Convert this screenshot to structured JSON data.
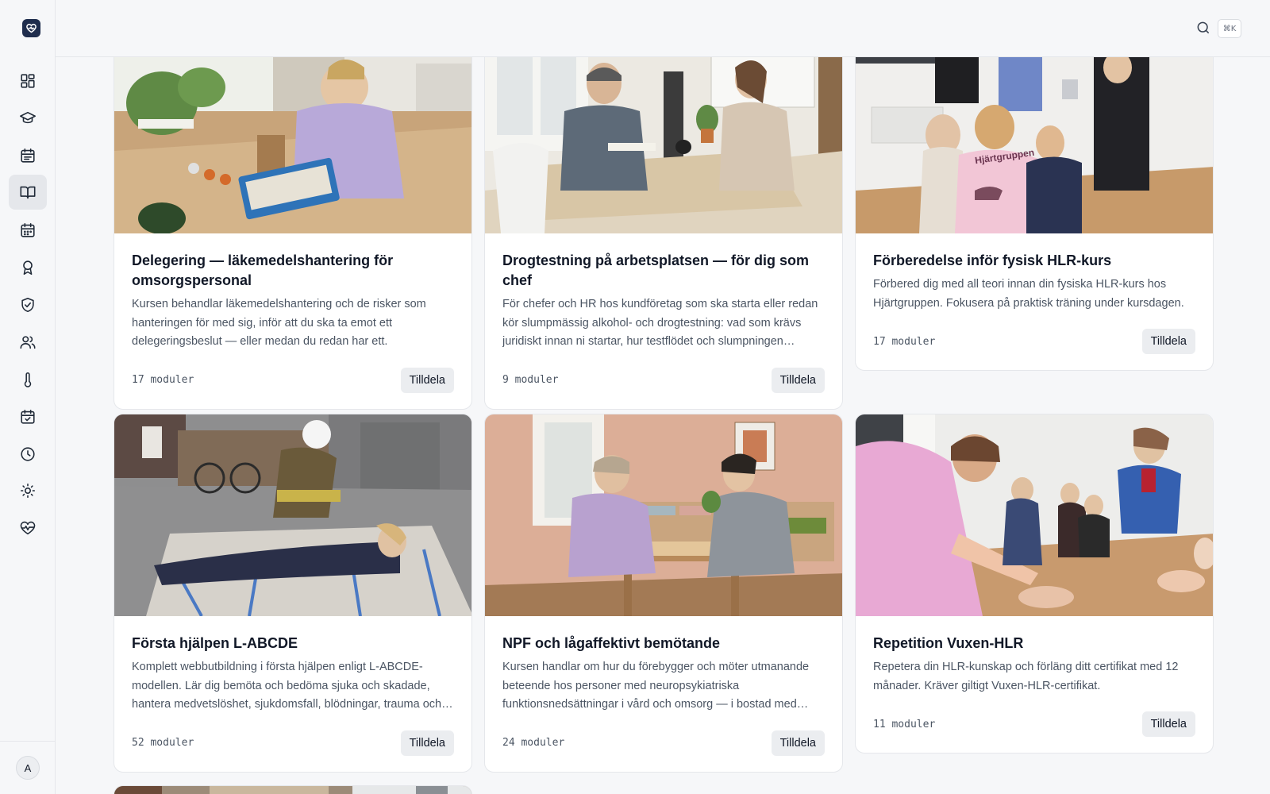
{
  "topbar": {
    "shortcut": "⌘K"
  },
  "sidebar": {
    "items": [
      {
        "icon": "dashboard-icon"
      },
      {
        "icon": "graduation-cap-icon"
      },
      {
        "icon": "calendar-list-icon"
      },
      {
        "icon": "book-open-icon",
        "active": true
      },
      {
        "icon": "calendar-icon"
      },
      {
        "icon": "award-icon"
      },
      {
        "icon": "shield-check-icon"
      },
      {
        "icon": "users-icon"
      },
      {
        "icon": "thermometer-icon"
      },
      {
        "icon": "calendar-check-icon"
      },
      {
        "icon": "clock-icon"
      },
      {
        "icon": "sun-icon"
      },
      {
        "icon": "heart-pulse-icon"
      }
    ],
    "avatar": "A"
  },
  "courses": [
    {
      "title": "Delegering — läkemedelshantering för omsorgspersonal",
      "description": "Kursen behandlar läkemedelshantering och de risker som hanteringen för med sig, inför att du ska ta emot ett delegeringsbeslut — eller medan du redan har ett.",
      "modules": "17 moduler",
      "button": "Tilldela"
    },
    {
      "title": "Drogtestning på arbetsplatsen — för dig som chef",
      "description": "För chefer och HR hos kundföretag som ska starta eller redan kör slumpmässig alkohol- och drogtestning: vad som krävs juridiskt innan ni startar, hur testflödet och slumpningen fungerar.",
      "modules": "9 moduler",
      "button": "Tilldela"
    },
    {
      "title": "Förberedelse inför fysisk HLR-kurs",
      "description": "Förbered dig med all teori innan din fysiska HLR-kurs hos Hjärtgruppen. Fokusera på praktisk träning under kursdagen.",
      "modules": "17 moduler",
      "button": "Tilldela",
      "image_text": "Hjärtgruppen"
    },
    {
      "title": "Första hjälpen L-ABCDE",
      "description": "Komplett webbutbildning i första hjälpen enligt L-ABCDE-modellen. Lär dig bemöta och bedöma sjuka och skadade, hantera medvetslöshet, sjukdomsfall, blödningar, trauma och mer.",
      "modules": "52 moduler",
      "button": "Tilldela"
    },
    {
      "title": "NPF och lågaffektivt bemötande",
      "description": "Kursen handlar om hur du förebygger och möter utmanande beteende hos personer med neuropsykiatriska funktionsnedsättningar i vård och omsorg — i bostad med särskild service.",
      "modules": "24 moduler",
      "button": "Tilldela"
    },
    {
      "title": "Repetition Vuxen-HLR",
      "description": "Repetera din HLR-kunskap och förläng ditt certifikat med 12 månader. Kräver giltigt Vuxen-HLR-certifikat.",
      "modules": "11 moduler",
      "button": "Tilldela"
    }
  ],
  "colors": {
    "brand": "#1f2d4d",
    "background": "#f6f7f9",
    "button": "#ebedf0"
  }
}
